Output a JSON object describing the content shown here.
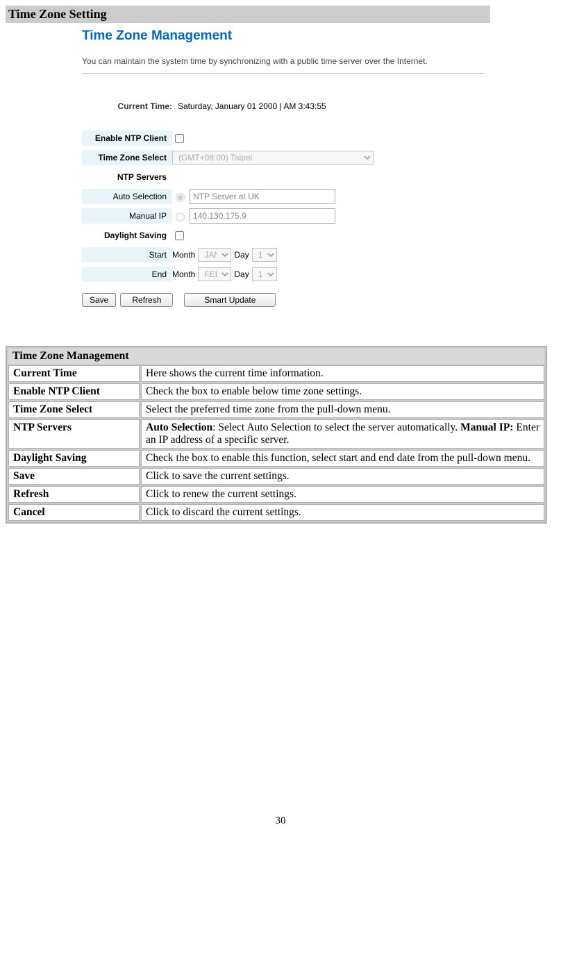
{
  "section_header": "Time Zone Setting",
  "ui": {
    "title": "Time Zone Management",
    "desc": "You can maintain the system time by synchronizing with a public time server over the Internet.",
    "labels": {
      "current_time": "Current Time:",
      "enable_ntp": "Enable NTP Client",
      "tz_select": "Time Zone Select",
      "ntp_servers": "NTP Servers",
      "auto_selection": "Auto Selection",
      "manual_ip": "Manual IP",
      "daylight": "Daylight Saving",
      "start": "Start",
      "end": "End",
      "month": "Month",
      "day": "Day"
    },
    "values": {
      "current_time_val": "Saturday, January 01 2000 | AM 3:43:55",
      "tz_value": "(GMT+08:00) Taipei",
      "auto_server": "NTP Server at UK",
      "manual_ip_val": "140.130.175.9",
      "start_month": "JAN",
      "start_day": "1",
      "end_month": "FEB",
      "end_day": "1"
    },
    "buttons": {
      "save": "Save",
      "refresh": "Refresh",
      "smart_update": "Smart Update"
    }
  },
  "table": {
    "header": "Time Zone Management",
    "rows": [
      {
        "k": "Current Time",
        "v": "Here shows the current time information."
      },
      {
        "k": "Enable NTP Client",
        "v": "Check the box to enable below time zone settings."
      },
      {
        "k": "Time Zone Select",
        "v": "Select the preferred time zone from the pull-down menu."
      },
      {
        "k": "NTP Servers",
        "v_html": true,
        "auto_label": "Auto Selection",
        "auto_text": ": Select Auto Selection to select the server automatically. ",
        "manual_label": "Manual IP:",
        "manual_text": " Enter an IP address of a specific server."
      },
      {
        "k": "Daylight Saving",
        "v": "Check the box to enable this function, select start and end date from the pull-down menu."
      },
      {
        "k": "Save",
        "v": "Click to save the current settings."
      },
      {
        "k": "Refresh",
        "v": "Click to renew the current settings."
      },
      {
        "k": "Cancel",
        "v": "Click to discard the current settings."
      }
    ]
  },
  "page_number": "30"
}
